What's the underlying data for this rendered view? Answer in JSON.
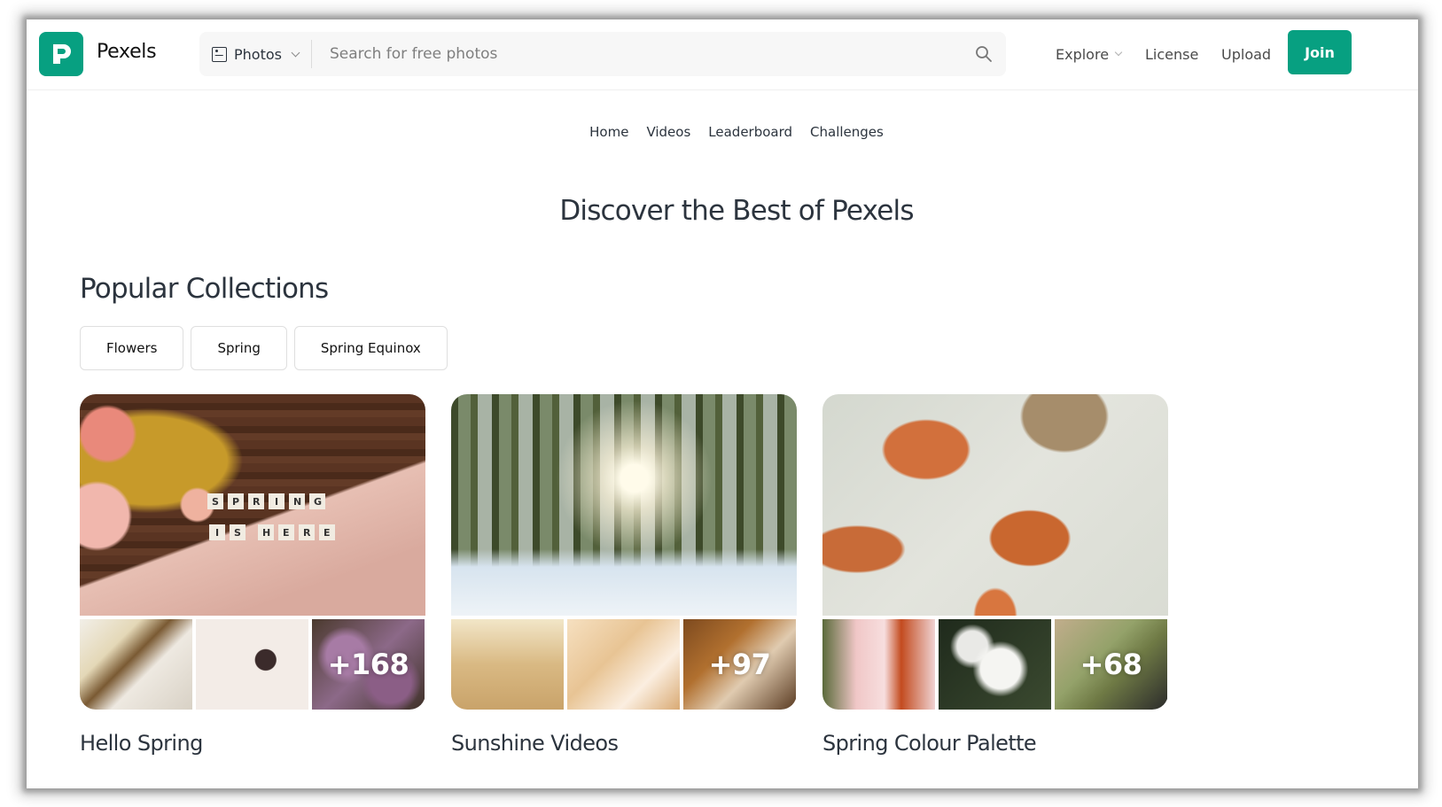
{
  "brand": {
    "name": "Pexels",
    "accent": "#07a081"
  },
  "search": {
    "type_label": "Photos",
    "placeholder": "Search for free photos",
    "value": ""
  },
  "header_nav": {
    "explore": "Explore",
    "license": "License",
    "upload": "Upload",
    "more": "•••",
    "join": "Join"
  },
  "subnav": [
    "Home",
    "Videos",
    "Leaderboard",
    "Challenges"
  ],
  "hero_title": "Discover the Best of Pexels",
  "popular": {
    "title": "Popular Collections",
    "chips": [
      "Flowers",
      "Spring",
      "Spring Equinox"
    ],
    "collections": [
      {
        "title": "Hello Spring",
        "more_count": "+168",
        "main_image": "flowers with 'SPRING IS HERE' letter tiles on wood"
      },
      {
        "title": "Sunshine Videos",
        "more_count": "+97",
        "main_image": "sun through snowy forest"
      },
      {
        "title": "Spring Colour Palette",
        "more_count": "+68",
        "main_image": "decorated orange eggs with mimosa"
      }
    ]
  }
}
